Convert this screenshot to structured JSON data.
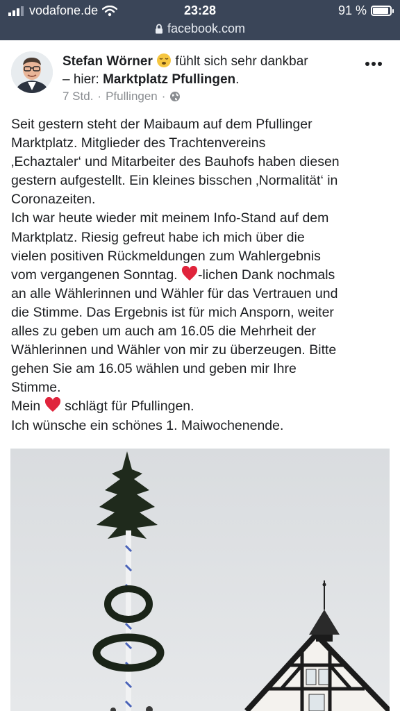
{
  "status_bar": {
    "carrier": "vodafone.de",
    "time": "23:28",
    "battery": "91 %",
    "battery_level": 0.91,
    "url": "facebook.com"
  },
  "post": {
    "author": "Stefan Wörner",
    "feeling": "fühlt sich sehr dankbar",
    "location_prefix": "– hier:",
    "location": "Marktplatz Pfullingen",
    "location_suffix": ".",
    "time": "7 Std.",
    "separator": "·",
    "place": "Pfullingen",
    "privacy_separator": "·",
    "body_lines": [
      "Seit gestern steht der Maibaum auf dem Pfullinger",
      "Marktplatz. Mitglieder des Trachtenvereins",
      "‚Echaztaler‘ und Mitarbeiter des Bauhofs haben diesen",
      "gestern aufgestellt. Ein kleines bisschen ‚Normalität‘ in",
      "Coronazeiten.",
      "Ich war heute wieder mit meinem Info-Stand auf dem",
      "Marktplatz. Riesig gefreut habe ich mich über die",
      "vielen positiven Rückmeldungen zum Wahlergebnis"
    ],
    "line_9_before": "vom vergangenen Sonntag.",
    "line_9_after": "-lichen Dank nochmals",
    "body_lines_2": [
      "an alle Wählerinnen und Wähler für das Vertrauen und",
      "die Stimme. Das Ergebnis ist für mich Ansporn, weiter",
      "alles zu geben um auch am 16.05 die Mehrheit der",
      "Wählerinnen und Wähler von mir zu überzeugen. Bitte",
      "gehen Sie am 16.05 wählen und geben mir Ihre",
      "Stimme."
    ],
    "line_16_before": "Mein",
    "line_16_after": "schlägt für Pfullingen.",
    "last_line": "Ich wünsche ein schönes 1. Maiwochenende."
  },
  "icons": {
    "signal": "signal-icon",
    "wifi": "wifi-icon",
    "lock": "lock-icon",
    "battery": "battery-icon",
    "globe": "globe-icon",
    "emoji": "relieved-face-icon",
    "heart": "heart-icon",
    "more": "more-dots-icon"
  },
  "colors": {
    "status_bar": "#3a4558",
    "text": "#1c1e21",
    "meta": "#8a8d91",
    "heart": "#e0243c"
  }
}
